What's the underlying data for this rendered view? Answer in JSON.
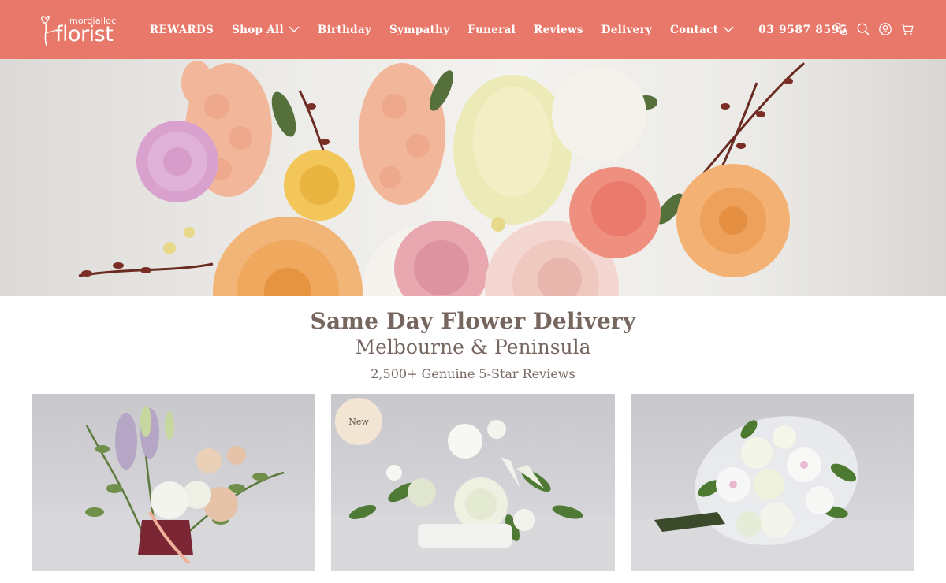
{
  "brand": {
    "small": "mordialloc",
    "name": "florist",
    "mark": "."
  },
  "nav": {
    "items": [
      {
        "label": "REWARDS",
        "dropdown": false
      },
      {
        "label": "Shop All",
        "dropdown": true
      },
      {
        "label": "Birthday",
        "dropdown": false
      },
      {
        "label": "Sympathy",
        "dropdown": false
      },
      {
        "label": "Funeral",
        "dropdown": false
      },
      {
        "label": "Reviews",
        "dropdown": false
      },
      {
        "label": "Delivery",
        "dropdown": false
      },
      {
        "label": "Contact",
        "dropdown": true
      }
    ],
    "phone": "03 9587 8595"
  },
  "header_icons": [
    "phone-icon",
    "search-icon",
    "account-icon",
    "cart-icon"
  ],
  "hero": {
    "title": "Same Day Flower Delivery",
    "subtitle": "Melbourne & Peninsula",
    "reviews": "2,500+ Genuine 5-Star Reviews"
  },
  "products": [
    {
      "badge": ""
    },
    {
      "badge": "New"
    },
    {
      "badge": ""
    }
  ],
  "colors": {
    "header": "#e8796a",
    "text": "#76665f",
    "badge": "#f3e5d4"
  }
}
